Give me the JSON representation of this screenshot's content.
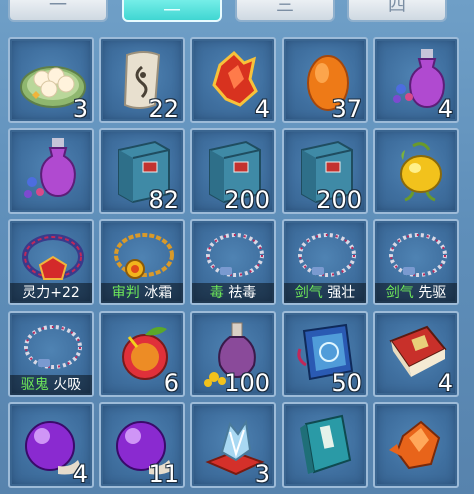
{
  "tabs": [
    {
      "label": "一"
    },
    {
      "label": "二"
    },
    {
      "label": "三"
    },
    {
      "label": "四"
    }
  ],
  "active_tab": 1,
  "inventory": {
    "row1": [
      {
        "icon": "dumpling-plate-icon",
        "count": "3"
      },
      {
        "icon": "scroll-icon",
        "count": "22"
      },
      {
        "icon": "red-crystal-icon",
        "count": "4"
      },
      {
        "icon": "orange-egg-icon",
        "count": "37"
      },
      {
        "icon": "purple-vase-icon",
        "count": "4"
      }
    ],
    "row2": [
      {
        "icon": "purple-vase-icon",
        "count": ""
      },
      {
        "icon": "blue-book-icon",
        "count": "82"
      },
      {
        "icon": "blue-book-icon",
        "count": "200"
      },
      {
        "icon": "blue-book-icon",
        "count": "200"
      },
      {
        "icon": "golden-fruit-icon",
        "count": ""
      }
    ],
    "row3": [
      {
        "icon": "red-necklace-icon",
        "label_green": "",
        "label_white": "灵力+22"
      },
      {
        "icon": "gold-necklace-icon",
        "label_green": "审判",
        "label_white": "冰霜"
      },
      {
        "icon": "bead-necklace-icon",
        "label_green": "毒",
        "label_white": "祛毒"
      },
      {
        "icon": "bead-necklace-icon",
        "label_green": "剑气",
        "label_white": "强壮"
      },
      {
        "icon": "bead-necklace-icon",
        "label_green": "剑气",
        "label_white": "先驱"
      }
    ],
    "row4": [
      {
        "icon": "bead-necklace-icon",
        "label_green": "驱鬼",
        "label_white": "火吸"
      },
      {
        "icon": "red-fruit-icon",
        "count": "6"
      },
      {
        "icon": "potion-coins-icon",
        "count": "100"
      },
      {
        "icon": "rune-book-icon",
        "count": "50"
      },
      {
        "icon": "red-book-icon",
        "count": "4"
      }
    ],
    "row5": [
      {
        "icon": "purple-orb-icon",
        "count": "4"
      },
      {
        "icon": "purple-orb-icon",
        "count": "11"
      },
      {
        "icon": "crystal-cushion-icon",
        "count": "3"
      },
      {
        "icon": "teal-book-icon",
        "count": ""
      },
      {
        "icon": "orange-gem-icon",
        "count": ""
      }
    ]
  }
}
